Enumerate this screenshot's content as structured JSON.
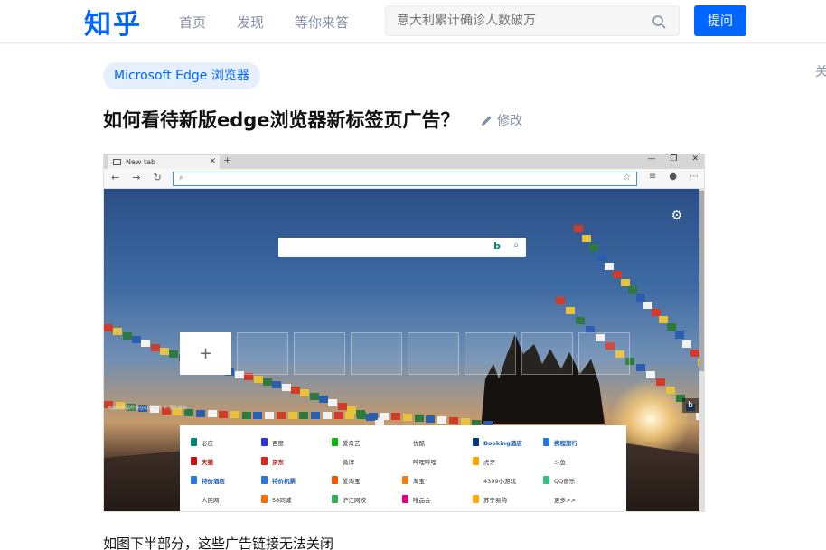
{
  "header": {
    "logo": "知乎",
    "nav": [
      "首页",
      "发现",
      "等你来答"
    ],
    "search_placeholder": "意大利累计确诊人数破万",
    "ask_label": "提问"
  },
  "question": {
    "topic": "Microsoft Edge 浏览器",
    "title": "如何看待新版edge浏览器新标签页广告？",
    "edit_label": "修改",
    "side_text": "关",
    "caption": "如图下半部分，这些广告链接无法关闭"
  },
  "browser_screenshot": {
    "tab_title": "New tab",
    "new_tab_symbol": "+",
    "window_controls": [
      "—",
      "❐",
      "✕"
    ],
    "nav_buttons": [
      "←",
      "→",
      "↻"
    ],
    "toolbar_icons": [
      "☆",
      "⋯"
    ],
    "add_tile": "+",
    "bing_mark": "b",
    "credit": "西藏的祈福经幡在山顶飘扬 © 图片版权",
    "ads": [
      {
        "label": "必应",
        "color": "#008373",
        "style": ""
      },
      {
        "label": "百度",
        "color": "#2932e1",
        "style": ""
      },
      {
        "label": "爱奇艺",
        "color": "#00be06",
        "style": ""
      },
      {
        "label": "优酷",
        "color": "#ffffff",
        "style": ""
      },
      {
        "label": "Booking酒店",
        "color": "#003580",
        "style": "strong"
      },
      {
        "label": "携程旅行",
        "color": "#2577e3",
        "style": "strong"
      },
      {
        "label": "天猫",
        "color": "#c4120f",
        "style": "red"
      },
      {
        "label": "京东",
        "color": "#e1251b",
        "style": "red"
      },
      {
        "label": "微博",
        "color": "#ffffff",
        "style": ""
      },
      {
        "label": "哔哩哔哩",
        "color": "#ffffff",
        "style": ""
      },
      {
        "label": "虎牙",
        "color": "#ffa200",
        "style": ""
      },
      {
        "label": "斗鱼",
        "color": "#ffffff",
        "style": ""
      },
      {
        "label": "特价酒店",
        "color": "#2577e3",
        "style": "strong"
      },
      {
        "label": "特价机票",
        "color": "#2577e3",
        "style": "strong"
      },
      {
        "label": "爱淘宝",
        "color": "#ff5000",
        "style": ""
      },
      {
        "label": "淘宝",
        "color": "#ff7a00",
        "style": ""
      },
      {
        "label": "4399小游戏",
        "color": "#ffffff",
        "style": ""
      },
      {
        "label": "QQ音乐",
        "color": "#31c27c",
        "style": ""
      },
      {
        "label": "人民网",
        "color": "#ffffff",
        "style": ""
      },
      {
        "label": "58同城",
        "color": "#ff6d00",
        "style": ""
      },
      {
        "label": "沪江网校",
        "color": "#28b34b",
        "style": ""
      },
      {
        "label": "唯品会",
        "color": "#e4007f",
        "style": ""
      },
      {
        "label": "苏宁易购",
        "color": "#ffaa00",
        "style": ""
      },
      {
        "label": "更多>>",
        "color": "#ffffff",
        "style": ""
      }
    ]
  },
  "colors": {
    "brand": "#0066ff"
  }
}
